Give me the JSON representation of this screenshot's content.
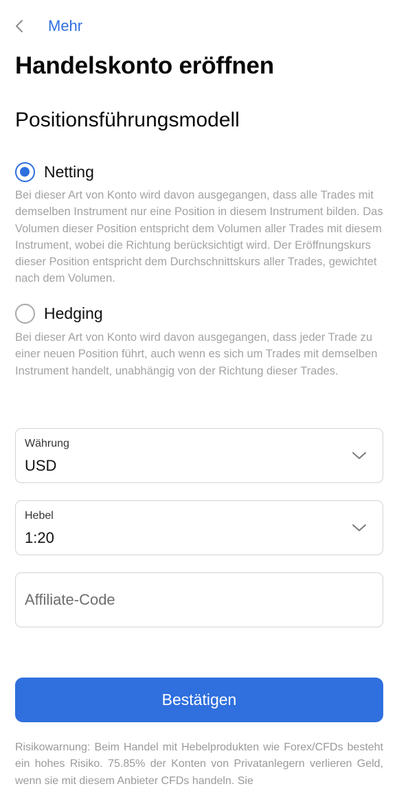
{
  "nav": {
    "back_label": "Mehr",
    "back_icon": "chevron-left-icon"
  },
  "page_title": "Handelskonto eröffnen",
  "section_title": "Positionsführungsmodell",
  "options": [
    {
      "label": "Netting",
      "checked": true,
      "description": "Bei dieser Art von Konto wird davon ausgegangen, dass alle Trades mit demselben Instrument nur eine Position in diesem Instrument bilden. Das Volumen dieser Position entspricht dem Volumen aller Trades mit diesem Instrument, wobei die Richtung berücksichtigt wird. Der Eröffnungskurs dieser Position entspricht dem Durchschnittskurs aller Trades, gewichtet nach dem Volumen."
    },
    {
      "label": "Hedging",
      "checked": false,
      "description": "Bei dieser Art von Konto wird davon ausgegangen, dass jeder Trade zu einer neuen Position führt, auch wenn es sich um Trades mit demselben Instrument handelt, unabhängig von der Richtung dieser Trades."
    }
  ],
  "currency": {
    "label": "Währung",
    "value": "USD"
  },
  "leverage": {
    "label": "Hebel",
    "value": "1:20"
  },
  "affiliate": {
    "placeholder": "Affiliate-Code",
    "value": ""
  },
  "confirm_label": "Bestätigen",
  "risk_warning": "Risikowarnung: Beim Handel mit Hebelprodukten wie Forex/CFDs besteht ein hohes Risiko. 75.85% der Konten von Privatanlegern verlieren Geld, wenn sie mit diesem Anbieter CFDs handeln. Sie",
  "colors": {
    "accent": "#2f6fde",
    "muted_text": "#a3a3a3",
    "border": "#d4d4d4"
  }
}
